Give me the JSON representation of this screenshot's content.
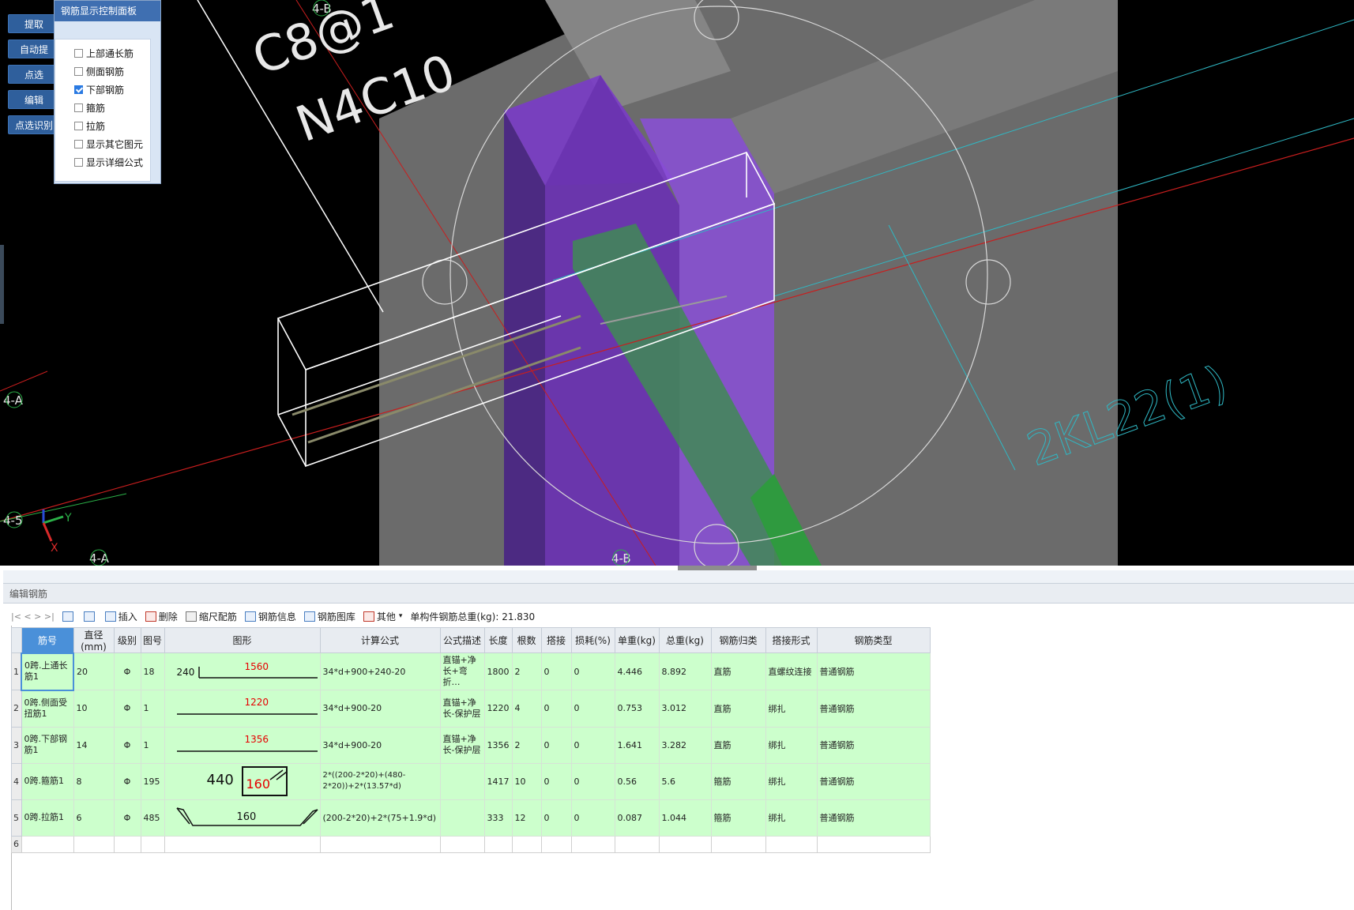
{
  "side_buttons": [
    "提取",
    "自动提",
    "点选",
    "编辑",
    "点选识别"
  ],
  "control_panel": {
    "title": "钢筋显示控制面板",
    "options": [
      {
        "label": "上部通长筋",
        "checked": false
      },
      {
        "label": "侧面钢筋",
        "checked": false
      },
      {
        "label": "下部钢筋",
        "checked": true
      },
      {
        "label": "箍筋",
        "checked": false
      },
      {
        "label": "拉筋",
        "checked": false
      },
      {
        "label": "显示其它图元",
        "checked": false
      },
      {
        "label": "显示详细公式",
        "checked": false
      }
    ]
  },
  "scene": {
    "annotation_top": "C8@1",
    "annotation_second": "N4C10",
    "beam_label": "2KL22(1)",
    "axis_labels": {
      "top_b": "4-B",
      "left_a": "4-A",
      "left_5": "4-5",
      "bottom_a": "4-A",
      "bottom_b": "4-B"
    },
    "triad": {
      "x": "X",
      "y": "Y"
    },
    "colors": {
      "purple": "#7a3cc8",
      "green": "#3f8a55",
      "grey": "#6b6b6b",
      "cyan": "#2fb8c4",
      "red": "#c81e1e"
    }
  },
  "editor": {
    "caption": "编辑钢筋",
    "toolbar": {
      "nav": "|<  <  >  >|",
      "insert": "插入",
      "delete": "删除",
      "scale": "缩尺配筋",
      "info": "钢筋信息",
      "library": "钢筋图库",
      "other": "其他",
      "total_label": "单构件钢筋总重(kg): 21.830"
    },
    "columns": [
      "筋号",
      "直径(mm)",
      "级别",
      "图号",
      "图形",
      "计算公式",
      "公式描述",
      "长度",
      "根数",
      "搭接",
      "损耗(%)",
      "单重(kg)",
      "总重(kg)",
      "钢筋归类",
      "搭接形式",
      "钢筋类型"
    ],
    "rows": [
      {
        "num": "1",
        "name": "0跨.上通长筋1",
        "dia": "20",
        "grade": "Φ",
        "fig": "18",
        "shape_left": "240",
        "shape_mid": "1560",
        "formula": "34*d+900+240-20",
        "desc": "直锚+净长+弯折…",
        "length": "1800",
        "count": "2",
        "lap": "0",
        "loss": "0",
        "unit_w": "4.446",
        "total_w": "8.892",
        "category": "直筋",
        "lap_type": "直螺纹连接",
        "type": "普通钢筋"
      },
      {
        "num": "2",
        "name": "0跨.侧面受扭筋1",
        "dia": "10",
        "grade": "Φ",
        "fig": "1",
        "shape_mid": "1220",
        "formula": "34*d+900-20",
        "desc": "直锚+净长-保护层",
        "length": "1220",
        "count": "4",
        "lap": "0",
        "loss": "0",
        "unit_w": "0.753",
        "total_w": "3.012",
        "category": "直筋",
        "lap_type": "绑扎",
        "type": "普通钢筋"
      },
      {
        "num": "3",
        "name": "0跨.下部钢筋1",
        "dia": "14",
        "grade": "Φ",
        "fig": "1",
        "shape_mid": "1356",
        "formula": "34*d+900-20",
        "desc": "直锚+净长-保护层",
        "length": "1356",
        "count": "2",
        "lap": "0",
        "loss": "0",
        "unit_w": "1.641",
        "total_w": "3.282",
        "category": "直筋",
        "lap_type": "绑扎",
        "type": "普通钢筋"
      },
      {
        "num": "4",
        "name": "0跨.箍筋1",
        "dia": "8",
        "grade": "Φ",
        "fig": "195",
        "shape_left": "440",
        "shape_mid": "160",
        "formula": "2*((200-2*20)+(480-2*20))+2*(13.57*d)",
        "desc": "",
        "length": "1417",
        "count": "10",
        "lap": "0",
        "loss": "0",
        "unit_w": "0.56",
        "total_w": "5.6",
        "category": "箍筋",
        "lap_type": "绑扎",
        "type": "普通钢筋"
      },
      {
        "num": "5",
        "name": "0跨.拉筋1",
        "dia": "6",
        "grade": "Φ",
        "fig": "485",
        "shape_mid": "160",
        "formula": "(200-2*20)+2*(75+1.9*d)",
        "desc": "",
        "length": "333",
        "count": "12",
        "lap": "0",
        "loss": "0",
        "unit_w": "0.087",
        "total_w": "1.044",
        "category": "箍筋",
        "lap_type": "绑扎",
        "type": "普通钢筋"
      }
    ],
    "empty_row_num": "6"
  }
}
